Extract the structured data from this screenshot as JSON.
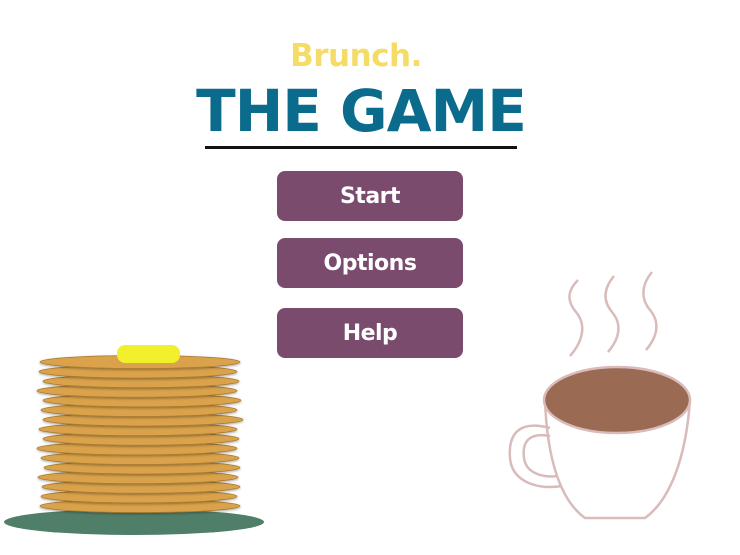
{
  "header": {
    "subtitle": "Brunch.",
    "title": "THE GAME"
  },
  "menu": [
    {
      "label": "Start"
    },
    {
      "label": "Options"
    },
    {
      "label": "Help"
    }
  ],
  "decor": {
    "pancake_stack": {
      "layers": 16
    },
    "coffee_cup": {
      "steam_lines": 3
    }
  },
  "colors": {
    "subtitle": "#f5dc66",
    "title": "#0b6b8c",
    "button": "#7b4b6e",
    "pancake": "#d9a24c",
    "pancake_edge": "#a8782e",
    "butter": "#f2ef2c",
    "plate": "#4f7e69",
    "coffee": "#9b6a52",
    "cup_outline": "#d9bbbb"
  }
}
